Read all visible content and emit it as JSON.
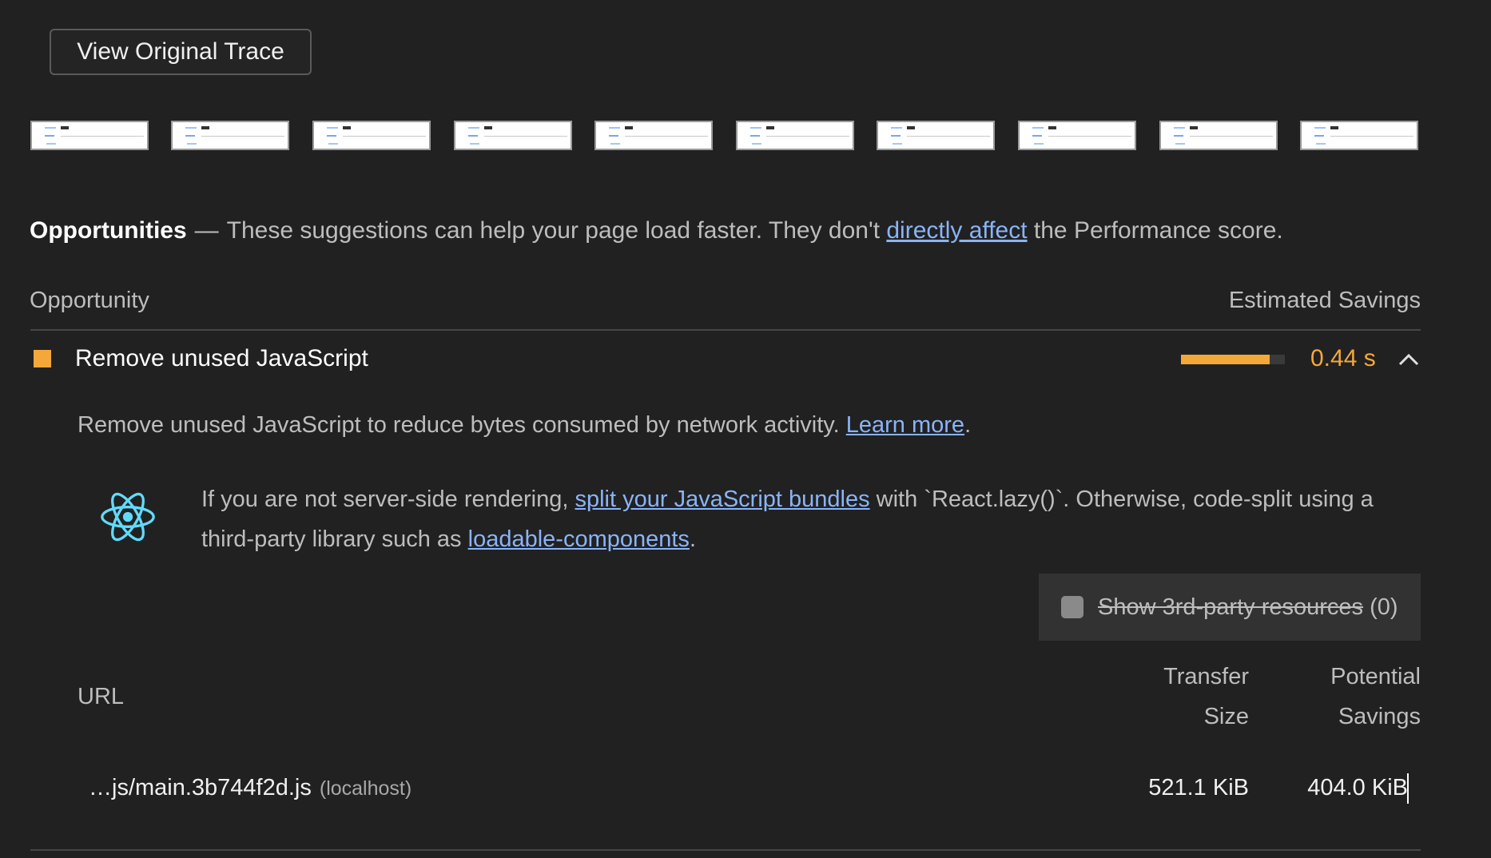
{
  "trace_button": {
    "label": "View Original Trace"
  },
  "filmstrip": {
    "frame_count": 10
  },
  "opportunities": {
    "title": "Opportunities",
    "separator": "—",
    "desc_before": "These suggestions can help your page load faster. They don't ",
    "desc_link": "directly affect",
    "desc_after": " the Performance score."
  },
  "columns": {
    "opportunity": "Opportunity",
    "estimated_savings": "Estimated Savings"
  },
  "audit": {
    "title": "Remove unused JavaScript",
    "savings": "0.44 s",
    "savings_bar_fraction": 0.85,
    "status_color": "#f4a83a",
    "description": "Remove unused JavaScript to reduce bytes consumed by network activity. ",
    "learn_more": "Learn more",
    "period": ".",
    "stack_icon": "react-icon",
    "stack_before": "If you are not server-side rendering, ",
    "stack_link1": "split your JavaScript bundles",
    "stack_middle": " with `React.lazy()`. Otherwise, code-split using a third-party library such as ",
    "stack_link2": "loadable-components",
    "stack_after": "."
  },
  "third_party": {
    "label": "Show 3rd-party resources",
    "count": "(0)",
    "checked": false
  },
  "table": {
    "headers": {
      "url": "URL",
      "transfer_line1": "Transfer",
      "transfer_line2": "Size",
      "potential_line1": "Potential",
      "potential_line2": "Savings"
    },
    "rows": [
      {
        "url": "…js/main.3b744f2d.js",
        "host": "(localhost)",
        "transfer_size": "521.1 KiB",
        "potential_savings": "404.0 KiB"
      }
    ]
  },
  "colors": {
    "background": "#212121",
    "accent_orange": "#f4a83a",
    "link": "#8ab4f8"
  }
}
